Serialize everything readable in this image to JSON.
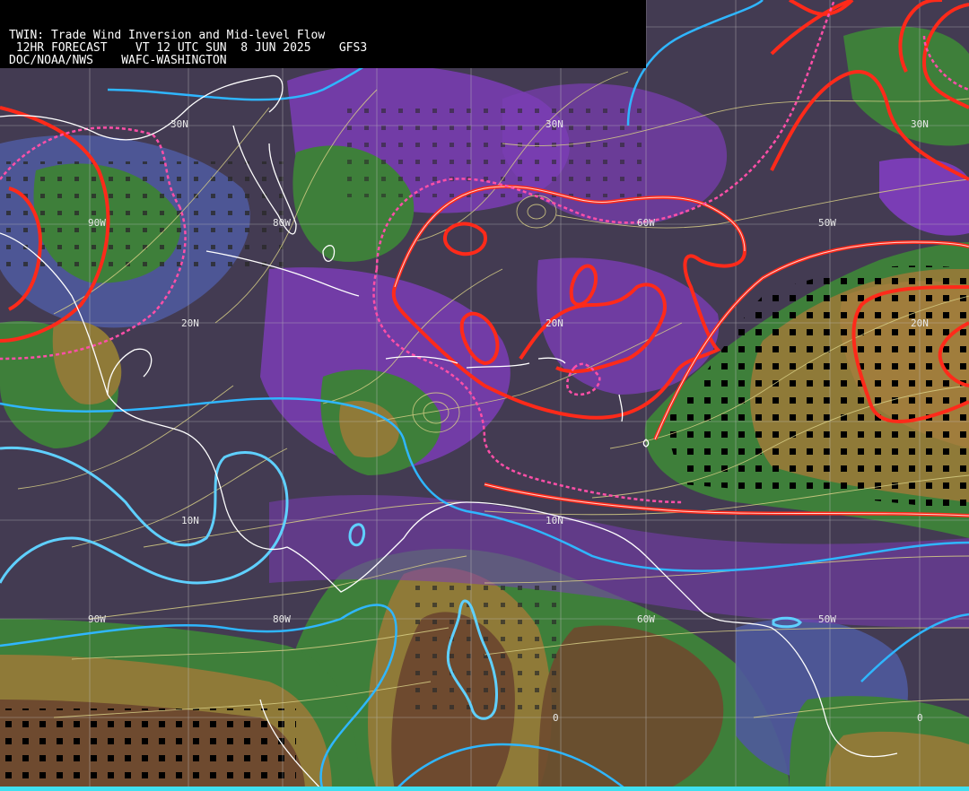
{
  "header": {
    "title": "TWIN: Trade Wind Inversion and Mid-level Flow",
    "forecast_line": " 12HR FORECAST    VT 12 UTC SUN  8 JUN 2025    GFS3",
    "source_line": "DOC/NOAA/NWS    WAFC-WASHINGTON"
  },
  "map": {
    "lat_labels": [
      "30N",
      "30N",
      "30N",
      "20N",
      "20N",
      "20N",
      "10N",
      "10N",
      "0",
      "0"
    ],
    "lon_labels": [
      "90W",
      "80W",
      "60W",
      "50W",
      "90W",
      "80W",
      "60W",
      "50W"
    ],
    "colors": {
      "background": "#433b52",
      "violet": "#7a3db5",
      "slate_blue": "#4f5a9c",
      "green": "#3e7f3a",
      "olive": "#8f7a38",
      "brown": "#6e4a2f",
      "red_contour": "#ff2a1a",
      "pink_dashed": "#ff4fa8",
      "cyan_contour": "#2fb6ff",
      "streamline": "#d8cf86",
      "coastline": "#ffffff"
    }
  }
}
